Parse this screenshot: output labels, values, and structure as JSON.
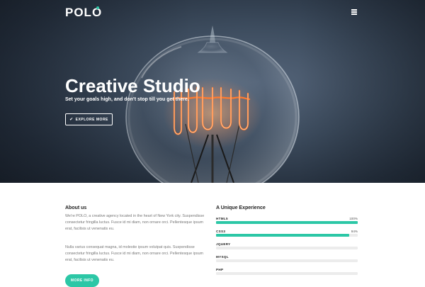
{
  "header": {
    "logo": "POLO",
    "menu_icon": "hamburger-menu-icon",
    "accent_color": "#2cc7a6"
  },
  "hero": {
    "title": "Creative Studio",
    "subtitle": "Set your goals high, and don't stop till you get there.",
    "button_label": "EXPLORE MORE",
    "button_icon": "check-icon",
    "image": "light-bulb"
  },
  "about": {
    "heading": "About us",
    "paragraph1": "We're POLO, a creative agency located in the heart of New York city. Suspendisse consectetur fringilla luctus. Fusce id mi diam, non ornare orci. Pellentesque ipsum erat, facilisis ut venenatis eu.",
    "paragraph2": "Nulla varius consequat magna, id molestie ipsum volutpat quis. Suspendisse consectetur fringilla luctus. Fusce id mi diam, non ornare orci. Pellentesque ipsum erat, facilisis ut venenatis eu.",
    "button_label": "MORE INFO"
  },
  "experience": {
    "heading": "A Unique Experience",
    "skills": [
      {
        "label": "HTML5",
        "percent": "100%",
        "fill": 1.0
      },
      {
        "label": "CSS3",
        "percent": "94%",
        "fill": 0.94
      },
      {
        "label": "JQUERY",
        "percent": "",
        "fill": 0.0
      },
      {
        "label": "MYSQL",
        "percent": "",
        "fill": 0.0
      },
      {
        "label": "PHP",
        "percent": "",
        "fill": 0.0
      }
    ]
  }
}
